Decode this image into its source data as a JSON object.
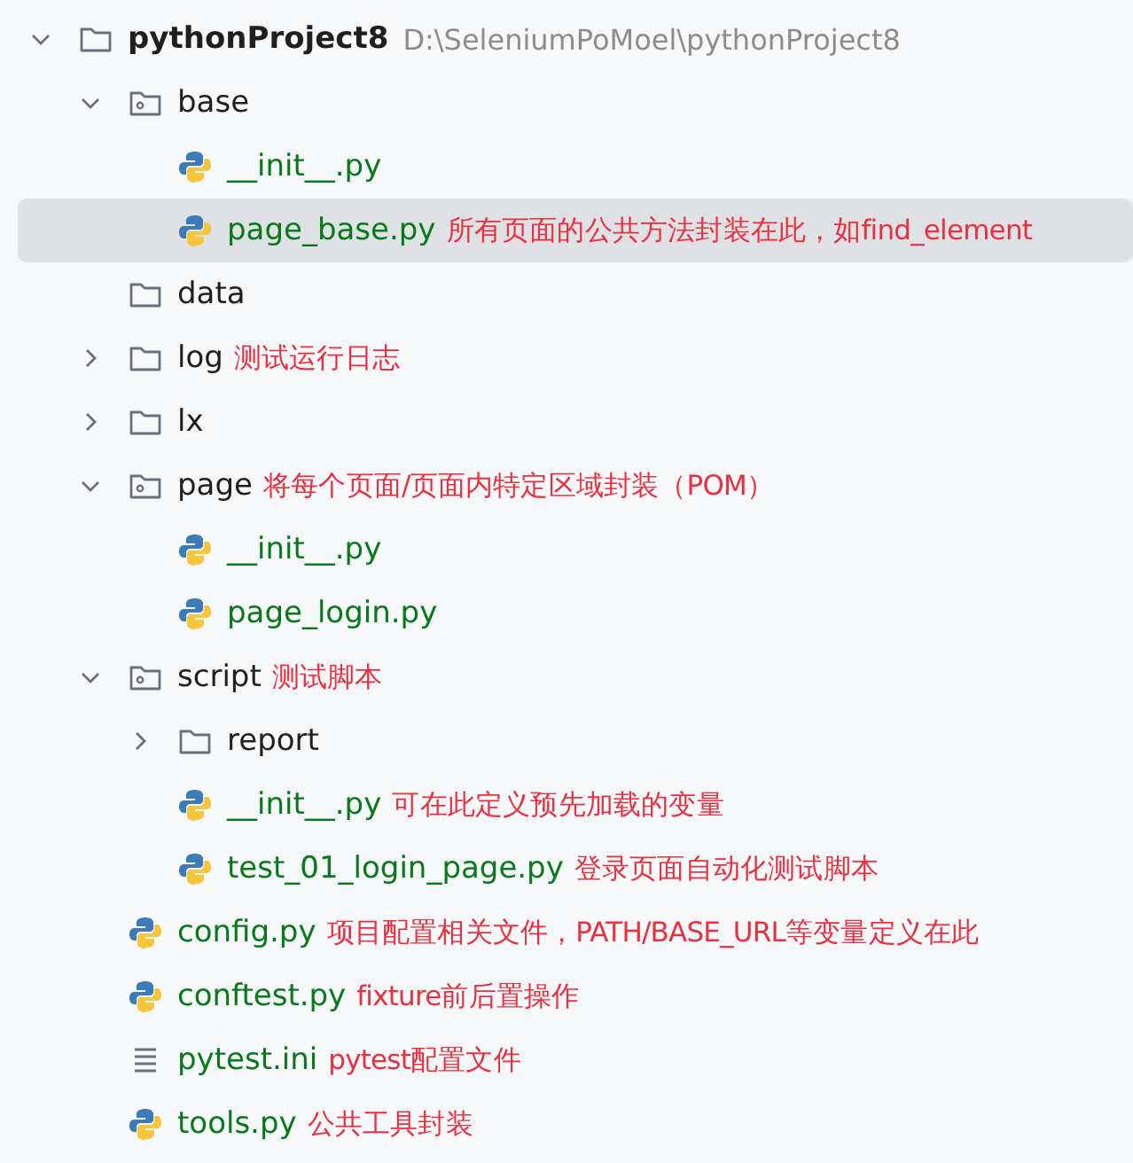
{
  "tree": [
    {
      "kind": "folder",
      "name": "pythonProject8",
      "path": "D:\\SeleniumPoMoel\\pythonProject8",
      "expanded": true,
      "selected": false,
      "children": [
        {
          "kind": "package",
          "name": "base",
          "expanded": true,
          "selected": false,
          "children": [
            {
              "kind": "python",
              "name": "__init__.py",
              "selected": false
            },
            {
              "kind": "python",
              "name": "page_base.py",
              "note": "所有页面的公共方法封装在此，如find_element",
              "selected": true
            }
          ]
        },
        {
          "kind": "folder",
          "name": "data",
          "selected": false
        },
        {
          "kind": "folder",
          "name": "log",
          "note": "测试运行日志",
          "expanded": false,
          "selected": false
        },
        {
          "kind": "folder",
          "name": "lx",
          "expanded": false,
          "selected": false
        },
        {
          "kind": "package",
          "name": "page",
          "note": "将每个页面/页面内特定区域封装（POM）",
          "expanded": true,
          "selected": false,
          "children": [
            {
              "kind": "python",
              "name": "__init__.py",
              "selected": false
            },
            {
              "kind": "python",
              "name": "page_login.py",
              "selected": false
            }
          ]
        },
        {
          "kind": "package",
          "name": "script",
          "note": "测试脚本",
          "expanded": true,
          "selected": false,
          "children": [
            {
              "kind": "folder",
              "name": "report",
              "expanded": false,
              "selected": false
            },
            {
              "kind": "python",
              "name": "__init__.py",
              "note": "可在此定义预先加载的变量",
              "selected": false
            },
            {
              "kind": "python",
              "name": "test_01_login_page.py",
              "note": "登录页面自动化测试脚本",
              "selected": false
            }
          ]
        },
        {
          "kind": "python",
          "name": "config.py",
          "note": "项目配置相关文件，PATH/BASE_URL等变量定义在此",
          "selected": false
        },
        {
          "kind": "python",
          "name": "conftest.py",
          "note": "fixture前后置操作",
          "selected": false
        },
        {
          "kind": "ini",
          "name": "pytest.ini",
          "note": "pytest配置文件",
          "selected": false
        },
        {
          "kind": "python",
          "name": "tools.py",
          "note": "公共工具封装",
          "selected": false
        }
      ]
    }
  ]
}
